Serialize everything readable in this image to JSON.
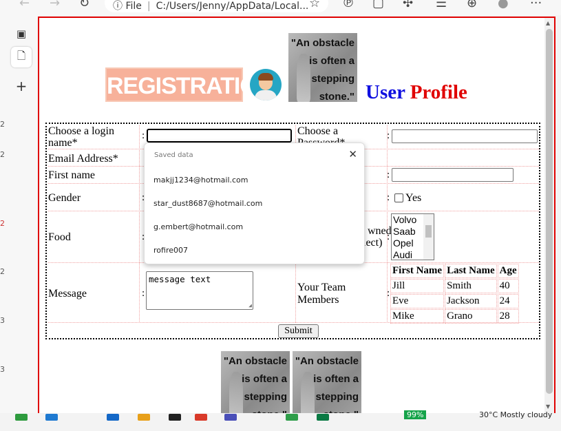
{
  "browser": {
    "address_prefix": "File",
    "address_url": "C:/Users/Jenny/AppData/Local...",
    "more_label": "···"
  },
  "header": {
    "registration_label": "REGISTRATION",
    "quote_text": "\"An obstacle is often a stepping stone.\"",
    "title_user": "User",
    "title_profile": "Profile"
  },
  "form": {
    "login_label": "Choose a login name*",
    "password_label": "Choose a Password*",
    "email_label": "Email Address*",
    "firstname_label": "First name",
    "gender_label": "Gender",
    "yes_label": "Yes",
    "food_label": "Food",
    "owned_label_1": "wned",
    "owned_label_2": "lect)",
    "cars": [
      "Volvo",
      "Saab",
      "Opel",
      "Audi"
    ],
    "message_label": "Message",
    "message_value": "message text",
    "team_label_1": "Your Team",
    "team_label_2": "Members",
    "submit_label": "Submit",
    "colon": ":"
  },
  "team_table": {
    "headers": [
      "First Name",
      "Last Name",
      "Age"
    ],
    "rows": [
      [
        "Jill",
        "Smith",
        "40"
      ],
      [
        "Eve",
        "Jackson",
        "24"
      ],
      [
        "Mike",
        "Grano",
        "28"
      ]
    ]
  },
  "autofill": {
    "heading": "Saved data",
    "items": [
      "makjj1234@hotmail.com",
      "star_dust8687@hotmail.com",
      "g.embert@hotmail.com",
      "rofire007"
    ]
  },
  "side": {
    "peek_numbers": [
      "2",
      "2",
      "2",
      "2",
      "3",
      "3"
    ]
  },
  "taskbar": {
    "battery": "99%",
    "weather": "30°C  Mostly cloudy"
  }
}
